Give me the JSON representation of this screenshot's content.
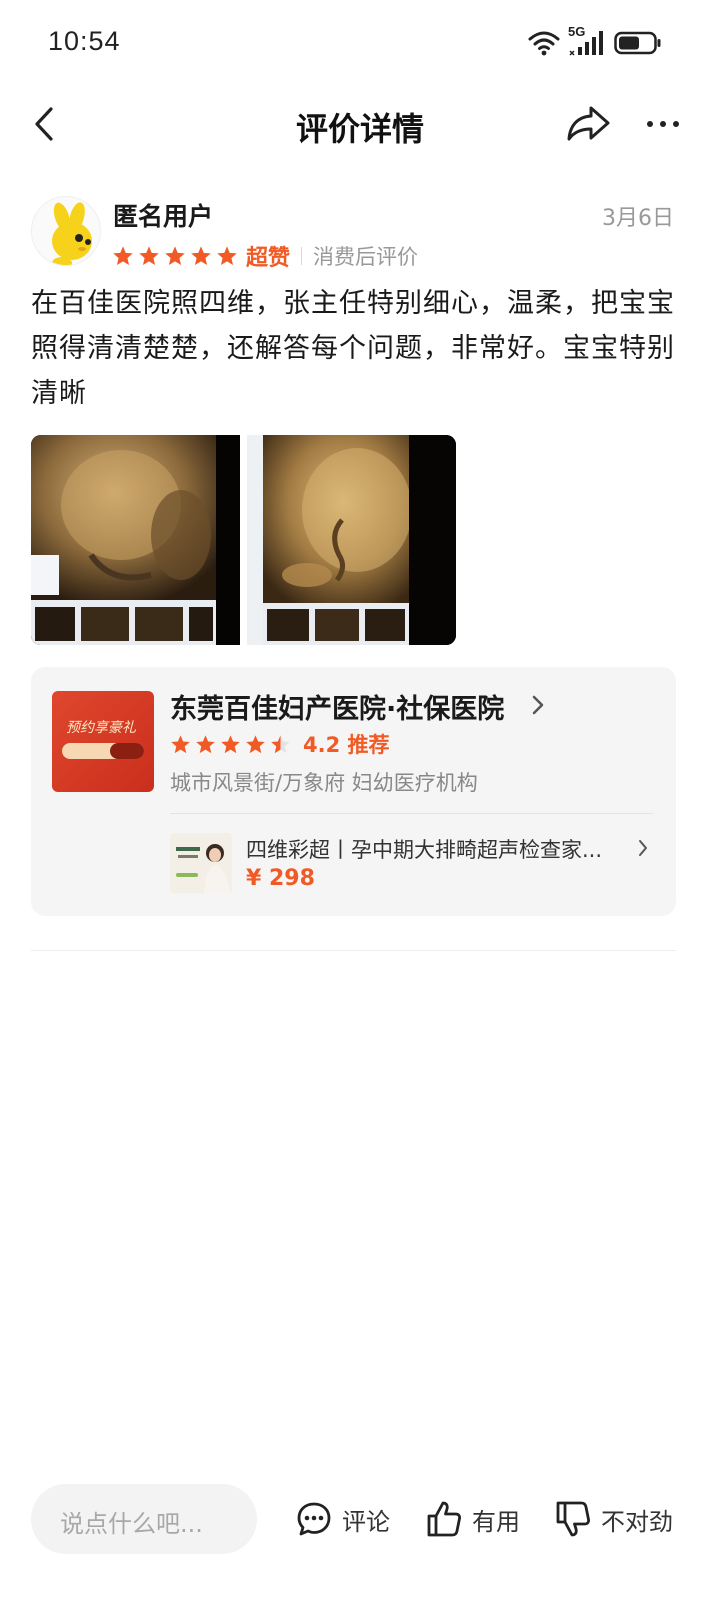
{
  "status_bar": {
    "time": "10:54",
    "network": "5G"
  },
  "header": {
    "title": "评价详情"
  },
  "review": {
    "user_name": "匿名用户",
    "date": "3月6日",
    "stars": 5,
    "rating_word": "超赞",
    "review_type": "消费后评价",
    "text": "在百佳医院照四维，张主任特别细心，温柔，把宝宝照得清清楚楚，还解答每个问题，非常好。宝宝特别清晰",
    "photo_count": 2
  },
  "merchant": {
    "name": "东莞百佳妇产医院·社保医院",
    "stars": 4.5,
    "score_text": "4.2 推荐",
    "location": "城市风景街/万象府 妇幼医疗机构",
    "thumb_title": "预约享豪礼",
    "product": {
      "name": "四维彩超丨孕中期大排畸超声检查家...",
      "price": "¥ 298"
    }
  },
  "bottom_bar": {
    "comment_placeholder": "说点什么吧...",
    "comment_label": "评论",
    "useful_label": "有用",
    "wrong_label": "不对劲"
  },
  "colors": {
    "accent": "#f15a24",
    "card_bg": "#f5f5f5",
    "muted": "#999999"
  }
}
